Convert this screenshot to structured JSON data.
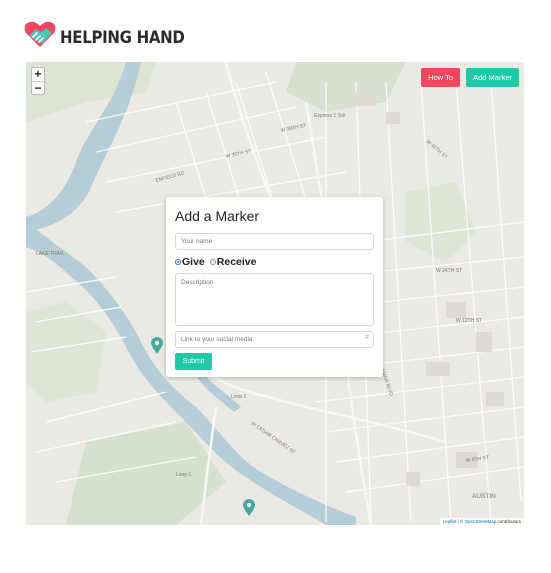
{
  "brand": {
    "name": "HELPING HAND",
    "logo_icon": "heart-handshake-icon"
  },
  "map": {
    "zoom_in": "+",
    "zoom_out": "−",
    "attribution_leaflet": "Leaflet",
    "attribution_sep": " | © ",
    "attribution_osm": "OpenStreetMap",
    "attribution_tail": " contributors",
    "labels": {
      "express_toll": "Express 1 Toll",
      "loop1_a": "Loop 1",
      "loop1_b": "Loop 1",
      "lake_trail": "LAKE TRAIL",
      "w_cesar_chavez": "W CESAR CHAVEZ ST",
      "austin": "AUSTIN",
      "w_38th": "W 38TH ST",
      "w_24th": "W 24TH ST",
      "w_12th": "W 12TH ST",
      "w_6th": "W 6TH ST",
      "lamar": "N LAMAR BLVD",
      "w_45th": "W 45TH ST",
      "enfield": "ENFIELD RD",
      "w_35th": "W 35TH ST"
    },
    "colors": {
      "water": "#b4cdd6",
      "pin": "#45a99f"
    }
  },
  "header_buttons": {
    "how_to": "How To",
    "add_marker": "Add Marker"
  },
  "modal": {
    "title": "Add a Marker",
    "name_placeholder": "Your name",
    "radio_give": "Give",
    "radio_receive": "Receive",
    "selected": "Give",
    "description_placeholder": "Description",
    "link_placeholder": "Link to your social media",
    "link_icon": "#",
    "submit": "Submit"
  },
  "colors": {
    "accent_red": "#f0475e",
    "accent_teal": "#1fc8a7"
  }
}
